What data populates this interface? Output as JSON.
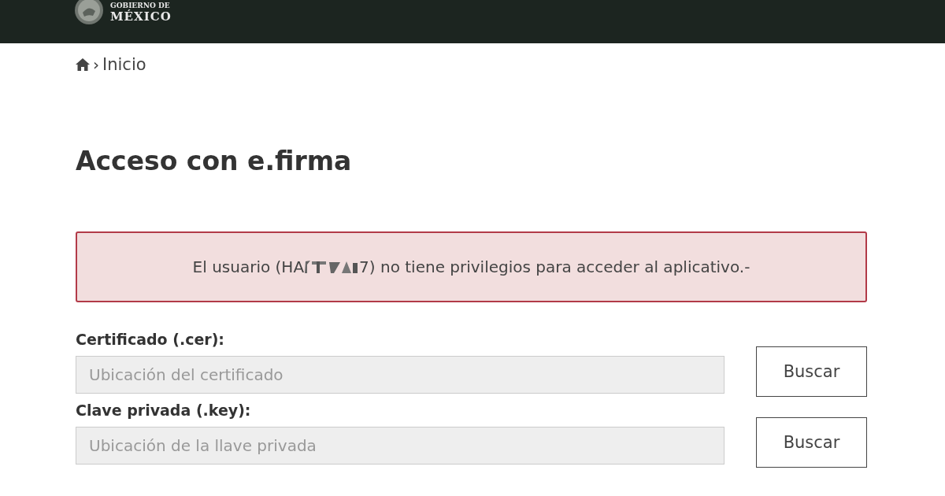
{
  "header": {
    "title_top": "GOBIERNO DE",
    "title_bottom": "MÉXICO"
  },
  "breadcrumb": {
    "separator": "›",
    "current": "Inicio"
  },
  "page_title": "Acceso con e.firma",
  "alert": {
    "before": "El usuario (HA",
    "after": "7) no tiene privilegios para acceder al aplicativo.-"
  },
  "fields": [
    {
      "label": "Certificado (.cer):",
      "placeholder": "Ubicación del certificado",
      "button": "Buscar"
    },
    {
      "label": "Clave privada (.key):",
      "placeholder": "Ubicación de la llave privada",
      "button": "Buscar"
    }
  ]
}
